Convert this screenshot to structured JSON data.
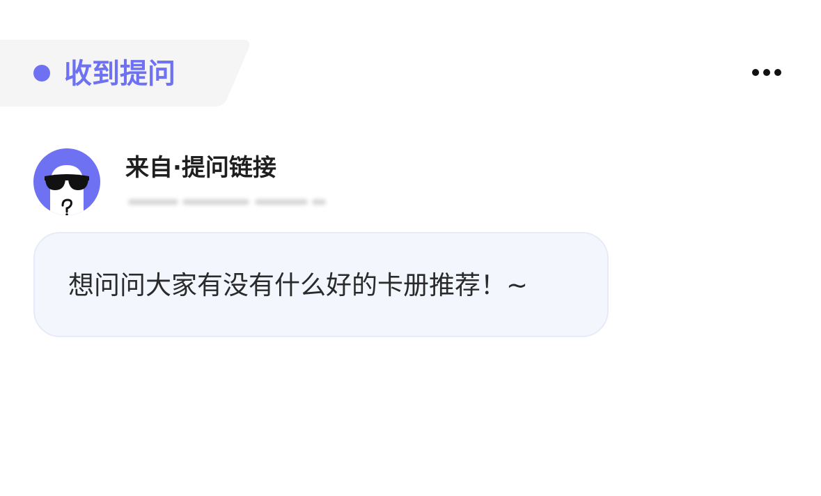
{
  "header": {
    "tag_label": "收到提问",
    "more_icon": "ellipsis-icon",
    "accent_color": "#6e72f2",
    "tag_bg_color": "#f5f5f6"
  },
  "source": {
    "title": "来自·提问链接",
    "avatar": "sunglasses-ghost-avatar"
  },
  "question": {
    "text": "想问问大家有没有什么好的卡册推荐！~"
  }
}
